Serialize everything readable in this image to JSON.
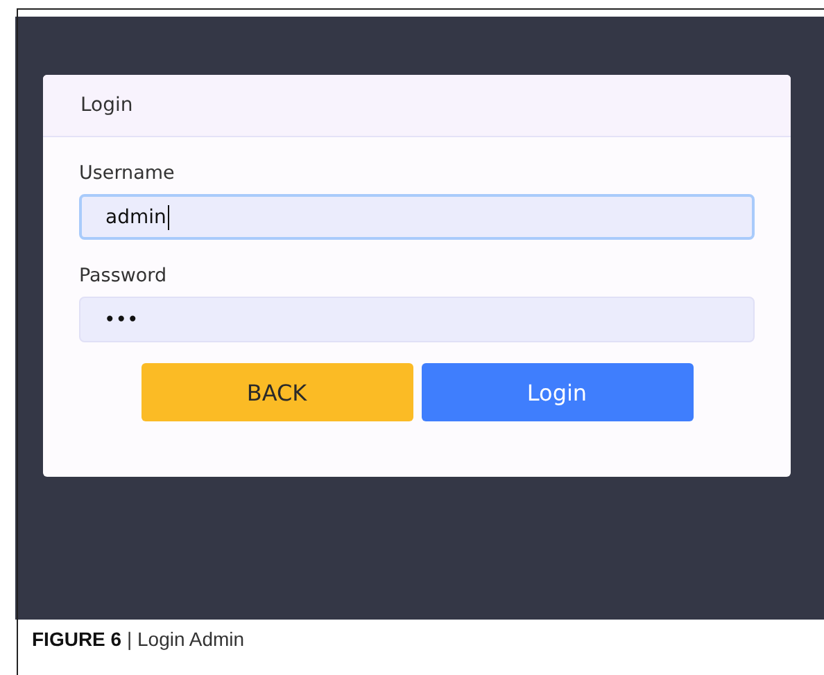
{
  "card": {
    "title": "Login"
  },
  "fields": [
    {
      "label": "Username",
      "value": "admin",
      "focused": true
    },
    {
      "label": "Password",
      "value": "•••",
      "focused": false
    }
  ],
  "buttons": [
    {
      "label": "BACK",
      "kind": "back"
    },
    {
      "label": "Login",
      "kind": "primary"
    }
  ],
  "caption": "**FIGURE 6** | Login Admin"
}
